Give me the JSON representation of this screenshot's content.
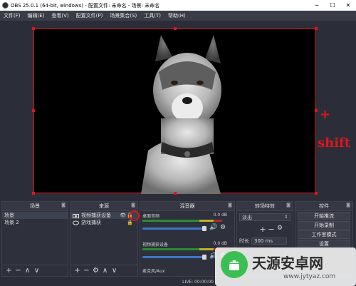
{
  "window": {
    "title": "OBS 25.0.1 (64-bit, windows) - 配置文件: 未命名 - 场景: 未命名",
    "minimize": "─",
    "maximize": "☐",
    "close": "✕"
  },
  "menu": [
    "文件(F)",
    "编辑(E)",
    "查看(V)",
    "配置文件(P)",
    "场景集合(S)",
    "工具(T)",
    "帮助(H)"
  ],
  "annotation": {
    "plus": "+",
    "shift": "shift",
    "color": "#e0141e"
  },
  "scenes": {
    "header": "场景",
    "items": [
      "场景",
      "场景 2"
    ],
    "toolbar": [
      "+",
      "−",
      "∧",
      "∨"
    ]
  },
  "sources": {
    "header": "来源",
    "items": [
      {
        "label": "视频捕获设备",
        "icon": "camera-icon"
      },
      {
        "label": "游戏捕获",
        "icon": "gamepad-icon"
      }
    ],
    "toolbar": [
      "+",
      "−",
      "⚙",
      "∧",
      "∨"
    ]
  },
  "mixer": {
    "header": "混音器",
    "channels": [
      {
        "name": "桌面音频",
        "db": "0.0 dB"
      },
      {
        "name": "视频捕获设备",
        "db": "0.0 dB"
      },
      {
        "name": "麦克风/Aux",
        "db": ""
      }
    ]
  },
  "transitions": {
    "header": "转场特效",
    "selected": "淡出",
    "duration_label": "时长",
    "duration_value": "300 ms"
  },
  "controls": {
    "header": "控件",
    "buttons": [
      "开始推流",
      "开始录制",
      "工作室模式",
      "设置"
    ]
  },
  "status": {
    "live": "LIVE: 00:00:00"
  },
  "watermark": {
    "title": "天源安卓网",
    "url": "www.jytyaz.com"
  }
}
